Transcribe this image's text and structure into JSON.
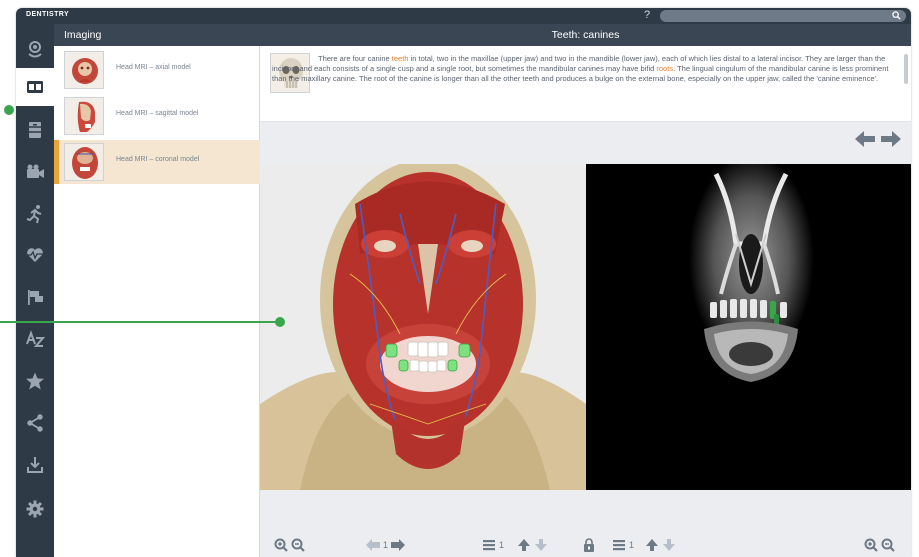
{
  "app": {
    "title": "DENTISTRY",
    "help_label": "?"
  },
  "sidebar": {
    "icons": [
      "brain-icon",
      "imaging-icon",
      "cabinet-icon",
      "video-icon",
      "running-icon",
      "heart-pulse-icon",
      "flags-icon",
      "az-index-icon",
      "star-icon",
      "share-icon",
      "download-icon",
      "settings-icon"
    ],
    "active_index": 1
  },
  "imaging_panel": {
    "title": "Imaging",
    "items": [
      {
        "label": "Head MRI – axial model",
        "active": false
      },
      {
        "label": "Head MRI – sagittal model",
        "active": false
      },
      {
        "label": "Head MRI – coronal model",
        "active": true
      }
    ]
  },
  "main": {
    "title": "Teeth: canines",
    "description": {
      "part1": "There are four canine ",
      "link1": "teeth",
      "part2": " in total, two in the maxillae (upper jaw) and two in the mandible (lower jaw), each of which lies distal to a lateral incisor. They are larger than the incisors and each consists of a single cusp and a single root, but sometimes the mandibular canines may have bifid ",
      "link2": "roots",
      "part3": ". The lingual cingulum of the mandibular canine is less prominent than the maxillary canine. The root of the canine is longer than all the other teeth and produces a bulge on the external bone, especially on the upper jaw, called the 'canine eminence'."
    }
  },
  "toolbar": {
    "page_number": "1",
    "layer_count_left": "1",
    "layer_count_right": "1"
  },
  "colors": {
    "sidebar_bg": "#2f3a47",
    "header_bg": "#3b4654",
    "accent_orange": "#e8832a",
    "active_item_bg": "#f4e6d0",
    "callout_green": "#3aa64c"
  }
}
